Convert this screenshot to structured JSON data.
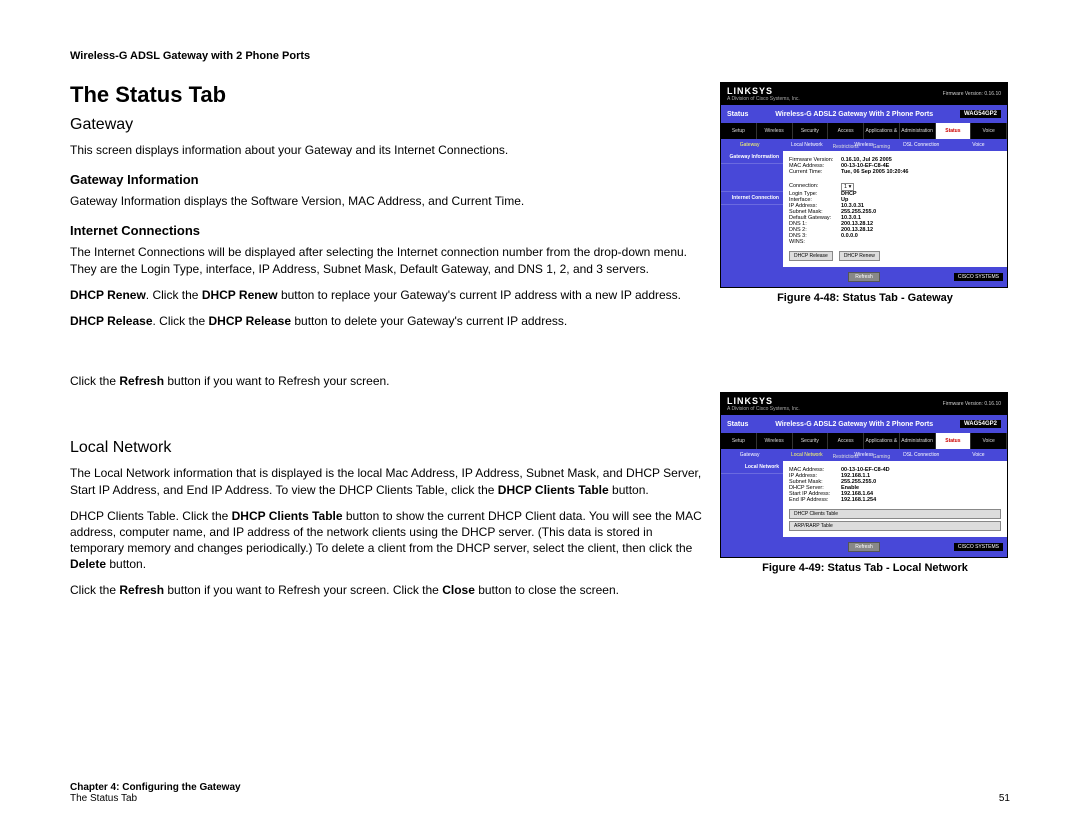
{
  "header": "Wireless-G ADSL Gateway with 2 Phone Ports",
  "title": "The Status Tab",
  "gateway": {
    "heading": "Gateway",
    "intro": "This screen displays information about your Gateway and its Internet Connections.",
    "info_h": "Gateway Information",
    "info_p": "Gateway Information displays the Software Version, MAC Address, and Current Time.",
    "conn_h": "Internet Connections",
    "conn_p": "The Internet Connections will be displayed after selecting the Internet connection number from the drop-down menu. They are the Login Type, interface, IP Address, Subnet Mask, Default Gateway, and DNS 1, 2, and 3 servers.",
    "renew_b": "DHCP Renew",
    "renew_t1": ". Click the ",
    "renew_b2": "DHCP Renew",
    "renew_t2": " button to replace your Gateway's current IP address with a new IP address.",
    "release_b": "DHCP Release",
    "release_t1": ". Click the ",
    "release_b2": "DHCP Release",
    "release_t2": " button to delete your Gateway's current IP address.",
    "refresh_t1": "Click the ",
    "refresh_b": "Refresh",
    "refresh_t2": " button if you want to Refresh your screen."
  },
  "local": {
    "heading": "Local Network",
    "p1a": "The Local Network information that is displayed is the local Mac Address, IP Address, Subnet Mask, and DHCP Server, Start IP Address, and End IP Address. To view the DHCP Clients Table, click the ",
    "p1b": "DHCP Clients Table",
    "p1c": " button.",
    "p2a": "DHCP Clients Table. Click the ",
    "p2b": "DHCP Clients Table",
    "p2c": " button to show the current DHCP Client data. You will see the MAC address, computer name, and IP address of the network clients using the DHCP server. (This data is stored in temporary memory and changes periodically.) To delete a client from the DHCP server, select the client, then click the ",
    "p2d": "Delete",
    "p2e": " button.",
    "p3a": "Click the ",
    "p3b": "Refresh",
    "p3c": " button if you want to Refresh your screen. Click the ",
    "p3d": "Close",
    "p3e": " button to close the screen."
  },
  "fig1_cap": "Figure 4-48: Status Tab - Gateway",
  "fig2_cap": "Figure 4-49: Status Tab - Local Network",
  "shot_common": {
    "logo": "LINKSYS",
    "sublogo": "A Division of Cisco Systems, Inc.",
    "firm": "Firmware Version: 0.16.10",
    "prod": "Wireless-G ADSL2 Gateway With 2 Phone Ports",
    "model": "WAG54GP2",
    "section": "Status",
    "tabs": [
      "Setup",
      "Wireless",
      "Security",
      "Access Restrictions",
      "Applications & Gaming",
      "Administration",
      "Status",
      "Voice"
    ],
    "refresh": "Refresh",
    "cisco": "CISCO SYSTEMS"
  },
  "shot1": {
    "subtabs": [
      "Gateway",
      "Local Network",
      "Wireless",
      "DSL Connection",
      "Voice"
    ],
    "side": [
      "Gateway Information",
      "Internet Connection"
    ],
    "rows": [
      [
        "Firmware Version:",
        "0.16.10, Jul 26 2005"
      ],
      [
        "MAC Address:",
        "00-13-10-EF-C8-4E"
      ],
      [
        "Current Time:",
        "Tue, 06 Sep 2005 10:20:46"
      ],
      [
        "Connection:",
        "1 ▾"
      ],
      [
        "Login Type:",
        "DHCP"
      ],
      [
        "Interface:",
        "Up"
      ],
      [
        "IP Address:",
        "10.3.0.31"
      ],
      [
        "Subnet Mask:",
        "255.255.255.0"
      ],
      [
        "Default Gateway:",
        "10.3.0.1"
      ],
      [
        "DNS 1:",
        "200.13.28.12"
      ],
      [
        "DNS 2:",
        "200.13.28.12"
      ],
      [
        "DNS 3:",
        "0.0.0.0"
      ],
      [
        "WINS:",
        ""
      ]
    ],
    "btn1": "DHCP Release",
    "btn2": "DHCP Renew"
  },
  "shot2": {
    "subtabs": [
      "Gateway",
      "Local Network",
      "Wireless",
      "DSL Connection",
      "Voice"
    ],
    "side": [
      "Local Network"
    ],
    "rows": [
      [
        "MAC Address:",
        "00-13-10-EF-C8-4D"
      ],
      [
        "IP Address:",
        "192.168.1.1"
      ],
      [
        "Subnet Mask:",
        "255.255.255.0"
      ],
      [
        "DHCP Server:",
        "Enable"
      ],
      [
        "Start IP Address:",
        "192.168.1.64"
      ],
      [
        "End IP Address:",
        "192.168.1.254"
      ]
    ],
    "btn1": "DHCP Clients Table",
    "btn2": "ARP/RARP Table"
  },
  "footer": {
    "chapter": "Chapter 4: Configuring the Gateway",
    "sub": "The Status Tab",
    "page": "51"
  }
}
